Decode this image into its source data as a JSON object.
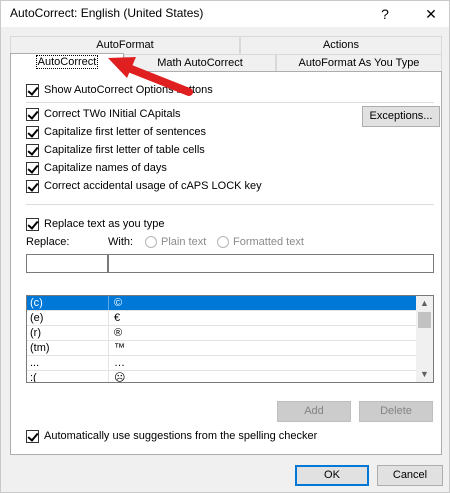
{
  "window": {
    "title": "AutoCorrect: English (United States)",
    "help": "?",
    "close": "✕"
  },
  "tabs": {
    "row1": [
      "AutoFormat",
      "Actions"
    ],
    "row2": [
      "AutoCorrect",
      "Math AutoCorrect",
      "AutoFormat As You Type"
    ]
  },
  "options": {
    "show_buttons": "Show AutoCorrect Options buttons",
    "two_initial": "Correct TWo INitial CApitals",
    "first_sentence": "Capitalize first letter of sentences",
    "table_cells": "Capitalize first letter of table cells",
    "days": "Capitalize names of days",
    "caps_lock": "Correct accidental usage of cAPS LOCK key",
    "exceptions_button": "Exceptions...",
    "replace_as_you_type": "Replace text as you type",
    "spelling_suggestions": "Automatically use suggestions from the spelling checker"
  },
  "replace": {
    "replace_label": "Replace:",
    "with_label": "With:",
    "plain_text": "Plain text",
    "formatted_text": "Formatted text",
    "replace_value": "",
    "with_value": ""
  },
  "entries": [
    {
      "from": "(c)",
      "to": "©"
    },
    {
      "from": "(e)",
      "to": "€"
    },
    {
      "from": "(r)",
      "to": "®"
    },
    {
      "from": "(tm)",
      "to": "™"
    },
    {
      "from": "...",
      "to": "…"
    },
    {
      "from": ":(",
      "to": "☹"
    }
  ],
  "buttons": {
    "add": "Add",
    "delete": "Delete",
    "ok": "OK",
    "cancel": "Cancel"
  },
  "colors": {
    "selection": "#0078d7",
    "annotation_arrow": "#e02020"
  }
}
